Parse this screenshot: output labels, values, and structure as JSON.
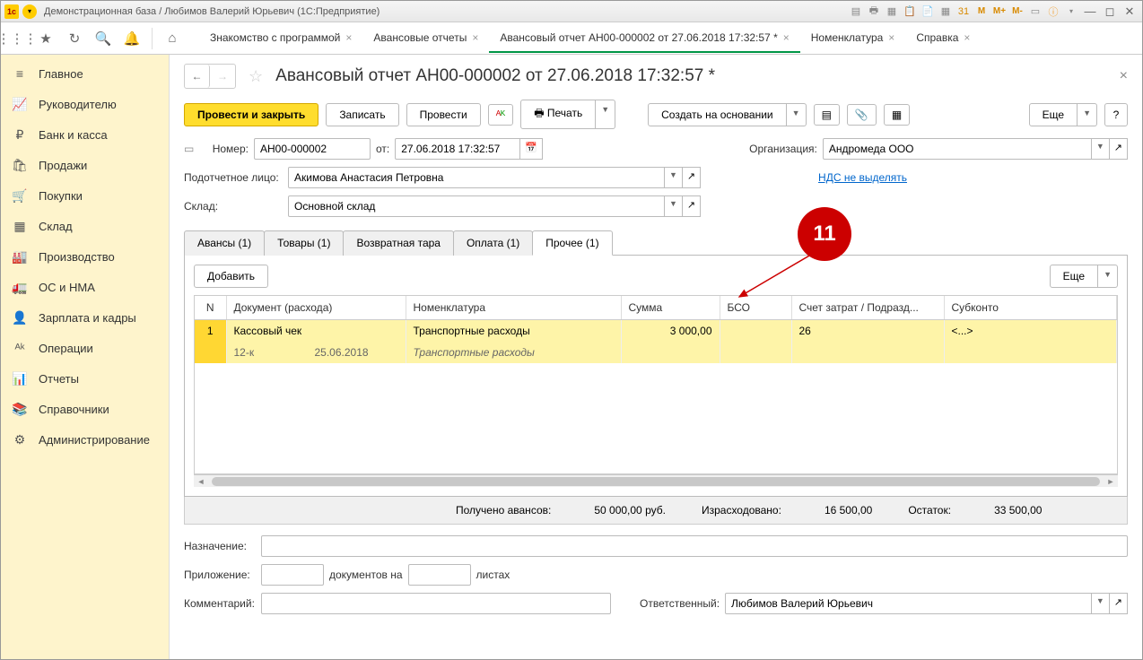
{
  "titlebar": {
    "title": "Демонстрационная база / Любимов Валерий Юрьевич  (1С:Предприятие)",
    "m1": "M",
    "m2": "M+",
    "m3": "M-"
  },
  "tabs": [
    {
      "label": "Знакомство с программой"
    },
    {
      "label": "Авансовые отчеты"
    },
    {
      "label": "Авансовый отчет АН00-000002 от 27.06.2018 17:32:57 *"
    },
    {
      "label": "Номенклатура"
    },
    {
      "label": "Справка"
    }
  ],
  "sidebar": [
    {
      "icon": "≡",
      "label": "Главное"
    },
    {
      "icon": "📈",
      "label": "Руководителю"
    },
    {
      "icon": "₽",
      "label": "Банк и касса"
    },
    {
      "icon": "🛍",
      "label": "Продажи"
    },
    {
      "icon": "🛒",
      "label": "Покупки"
    },
    {
      "icon": "▦",
      "label": "Склад"
    },
    {
      "icon": "🏭",
      "label": "Производство"
    },
    {
      "icon": "🚛",
      "label": "ОС и НМА"
    },
    {
      "icon": "👤",
      "label": "Зарплата и кадры"
    },
    {
      "icon": "ᴬᵏ",
      "label": "Операции"
    },
    {
      "icon": "📊",
      "label": "Отчеты"
    },
    {
      "icon": "📚",
      "label": "Справочники"
    },
    {
      "icon": "⚙",
      "label": "Администрирование"
    }
  ],
  "doc": {
    "title": "Авансовый отчет АН00-000002 от 27.06.2018 17:32:57 *",
    "actions": {
      "post_close": "Провести и закрыть",
      "save": "Записать",
      "post": "Провести",
      "print": "Печать",
      "create_based": "Создать на основании",
      "more": "Еще"
    },
    "labels": {
      "number": "Номер:",
      "from": "от:",
      "org": "Организация:",
      "person": "Подотчетное лицо:",
      "warehouse": "Склад:",
      "nds": "НДС не выделять",
      "add": "Добавить",
      "more2": "Еще",
      "purpose": "Назначение:",
      "attachment": "Приложение:",
      "docs_on": "документов на",
      "sheets": "листах",
      "comment": "Комментарий:",
      "responsible": "Ответственный:"
    },
    "values": {
      "number": "АН00-000002",
      "date": "27.06.2018 17:32:57",
      "org": "Андромеда ООО",
      "person": "Акимова Анастасия Петровна",
      "warehouse": "Основной склад",
      "responsible": "Любимов Валерий Юрьевич"
    },
    "inner_tabs": [
      "Авансы (1)",
      "Товары (1)",
      "Возвратная тара",
      "Оплата (1)",
      "Прочее (1)"
    ],
    "table": {
      "headers": [
        "N",
        "Документ (расхода)",
        "Номенклатура",
        "Сумма",
        "БСО",
        "Счет затрат / Подразд...",
        "Субконто"
      ],
      "row1": {
        "n": "1",
        "doc": "Кассовый чек",
        "nom": "Транспортные расходы",
        "sum": "3 000,00",
        "bso": "",
        "account": "26",
        "subk": "<...>"
      },
      "row2": {
        "doc_num": "12-к",
        "doc_date": "25.06.2018",
        "nom_desc": "Транспортные расходы"
      }
    },
    "summary": {
      "received_label": "Получено авансов:",
      "received": "50 000,00",
      "currency": "руб.",
      "spent_label": "Израсходовано:",
      "spent": "16 500,00",
      "balance_label": "Остаток:",
      "balance": "33 500,00"
    }
  },
  "annotation": "11"
}
